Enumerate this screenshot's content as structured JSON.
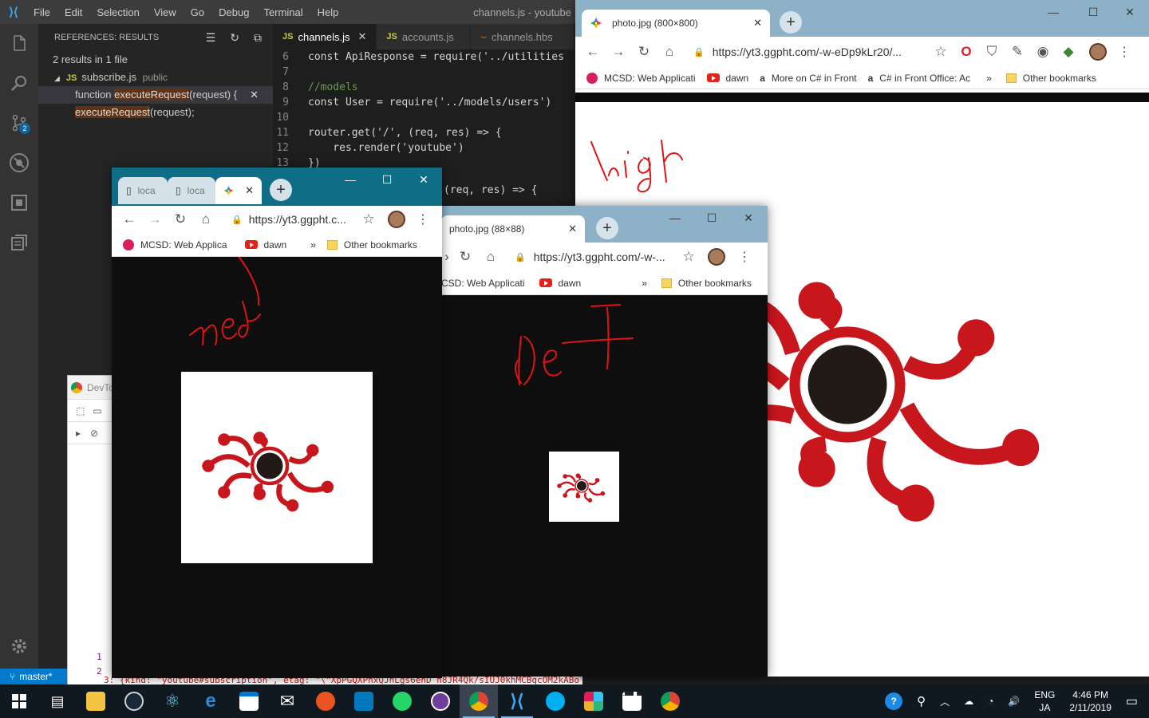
{
  "vscode": {
    "menu": [
      "File",
      "Edit",
      "Selection",
      "View",
      "Go",
      "Debug",
      "Terminal",
      "Help"
    ],
    "window_title": "channels.js - youtube",
    "sidebar": {
      "header": "REFERENCES: RESULTS",
      "summary": "2 results in 1 file",
      "file": "subscribe.js",
      "file_dir": "public",
      "result1_pre": "function ",
      "result1_match": "executeRequest",
      "result1_post": "(request) {",
      "result2_match": "executeRequest",
      "result2_post": "(request);"
    },
    "tabs": [
      "channels.js",
      "accounts.js",
      "channels.hbs"
    ],
    "code": [
      {
        "n": "6",
        "t": "const ApiResponse = require('../utilities"
      },
      {
        "n": "7",
        "t": ""
      },
      {
        "n": "8",
        "t": "//models"
      },
      {
        "n": "9",
        "t": "const User = require('../models/users')"
      },
      {
        "n": "10",
        "t": ""
      },
      {
        "n": "11",
        "t": "router.get('/', (req, res) => {"
      },
      {
        "n": "12",
        "t": "    res.render('youtube')"
      },
      {
        "n": "13",
        "t": "})"
      }
    ],
    "code_peek": "(req, res) => {",
    "source_control_badge": "2",
    "status_branch": "master*",
    "console_line": "3: {kind: \"youtube#subscription\", etag: \"\\\"XpPGQXPnxQJhLgs6enD_n8JR4Qk/sIUJ0khMCBqcOM2kABo"
  },
  "chrome_high": {
    "tab_title": "photo.jpg (800×800)",
    "url": "https://yt3.ggpht.com/-w-eDp9kLr20/...",
    "bookmarks": [
      "MCSD: Web Applicati",
      "dawn",
      "More on C# in Front",
      "C# in Front Office: Ac"
    ],
    "other_bookmarks": "Other bookmarks",
    "annotation": "high"
  },
  "chrome_med": {
    "tab1": "loca",
    "tab2": "loca",
    "url": "https://yt3.ggpht.c...",
    "bookmarks": [
      "MCSD: Web Applica",
      "dawn"
    ],
    "other_bookmarks": "Other bookmarks",
    "annotation": "med"
  },
  "chrome_def": {
    "tab_title": "photo.jpg (88×88)",
    "url": "https://yt3.ggpht.com/-w-...",
    "bookmarks": [
      "CSD: Web Applicati",
      "dawn"
    ],
    "other_bookmarks": "Other bookmarks",
    "annotation": "def"
  },
  "devtools": {
    "title": "DevTo",
    "lines": [
      "1",
      "2"
    ]
  },
  "taskbar": {
    "lang1": "ENG",
    "lang2": "JA",
    "time": "4:46 PM",
    "date": "2/11/2019"
  },
  "colors": {
    "logo_red": "#c8161d",
    "logo_dark": "#221a17",
    "vscode_blue": "#007acc"
  }
}
